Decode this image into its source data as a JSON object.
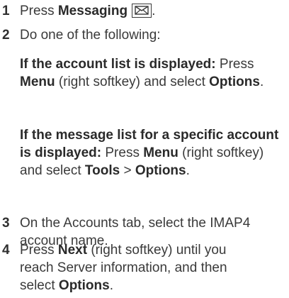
{
  "steps": [
    {
      "number": "1",
      "prefix": "Press ",
      "bold": "Messaging",
      "icon": "envelope-icon"
    },
    {
      "number": "2",
      "text": "Do one of the following:",
      "cases": [
        {
          "condition": "If the account list is displayed:",
          "t1": " Press ",
          "b1": "Menu",
          "t2": " (right softkey) and select ",
          "b2": "Options",
          "t3": "."
        },
        {
          "condition": "If the message list for a specific account is displayed:",
          "t1": " Press ",
          "b1": "Menu",
          "t2": " (right softkey) and select ",
          "b2": "Tools",
          "t3": " > ",
          "b3": "Options",
          "t4": "."
        }
      ]
    },
    {
      "number": "3",
      "text": "On the Accounts tab, select the IMAP4 account name."
    },
    {
      "number": "4",
      "prefix": "Press ",
      "bold1": "Next",
      "middle": " (right softkey) until you reach Server information, and then select ",
      "bold2": "Options",
      "suffix": "."
    }
  ]
}
